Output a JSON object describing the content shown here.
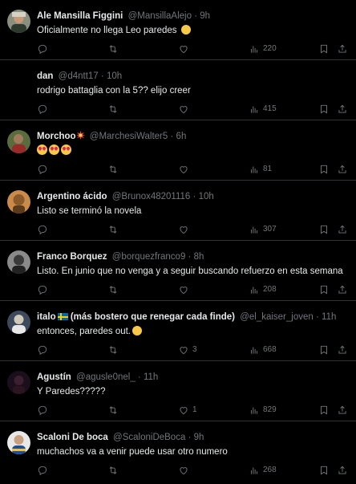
{
  "tweets": [
    {
      "name": "Ale Mansilla Figgini",
      "handle": "@MansillaAlejo",
      "sep": "·",
      "time": "9h",
      "text": "Oficialmente no llega Leo paredes",
      "emoji": "smile-face",
      "replies": "",
      "retweets": "",
      "likes": "",
      "views": "220",
      "avatar_color": "#6b7c5a"
    },
    {
      "name": "dan",
      "handle": "@d4ntt17",
      "sep": "·",
      "time": "10h",
      "text": "rodrigo battaglia con la 5?? elijo creer",
      "replies": "",
      "retweets": "",
      "likes": "",
      "views": "415",
      "avatar_color": ""
    },
    {
      "name": "Morchoo",
      "handle": "@MarchesiWalter5",
      "sep": "·",
      "time": "6h",
      "text": "",
      "emoji": "three-heart-eyes",
      "replies": "",
      "retweets": "",
      "likes": "",
      "views": "81",
      "avatar_color": "#4a5a3a"
    },
    {
      "name": "Argentino ácido",
      "handle": "@Brunox48201116",
      "sep": "·",
      "time": "10h",
      "text": "Listo se terminó la novela",
      "replies": "",
      "retweets": "",
      "likes": "",
      "views": "307",
      "avatar_color": "#b9773a"
    },
    {
      "name": "Franco Borquez",
      "handle": "@borquezfranco9",
      "sep": "·",
      "time": "8h",
      "text": "Listo. En junio que no venga y a seguir buscando refuerzo en esta semana",
      "replies": "",
      "retweets": "",
      "likes": "",
      "views": "208",
      "avatar_color": "#777777"
    },
    {
      "name": "italo",
      "name_suffix": "(más bostero que renegar cada finde)",
      "handle": "@el_kaiser_joven",
      "sep": "·",
      "time": "11h",
      "text": "entonces, paredes out.",
      "emoji": "smile-face",
      "replies": "",
      "retweets": "",
      "likes": "3",
      "views": "668",
      "avatar_color": "#3d4a5c"
    },
    {
      "name": "Agustín",
      "handle": "@agusle0nel_",
      "sep": "·",
      "time": "11h",
      "text": "Y Paredes?????",
      "replies": "",
      "retweets": "",
      "likes": "1",
      "views": "829",
      "avatar_color": "#2a1a2a"
    },
    {
      "name": "Scaloni De boca",
      "handle": "@ScaloniDeBoca",
      "sep": "·",
      "time": "9h",
      "text": "muchachos va a venir  puede usar otro numero",
      "replies": "",
      "retweets": "",
      "likes": "",
      "views": "268",
      "avatar_color": "#1d4e9e"
    }
  ],
  "colors": {
    "background": "#000000",
    "text": "#e7e9ea",
    "muted": "#71767b",
    "border": "#2f3336"
  },
  "icons": [
    "reply-icon",
    "retweet-icon",
    "like-icon",
    "views-icon",
    "bookmark-icon",
    "share-icon"
  ]
}
